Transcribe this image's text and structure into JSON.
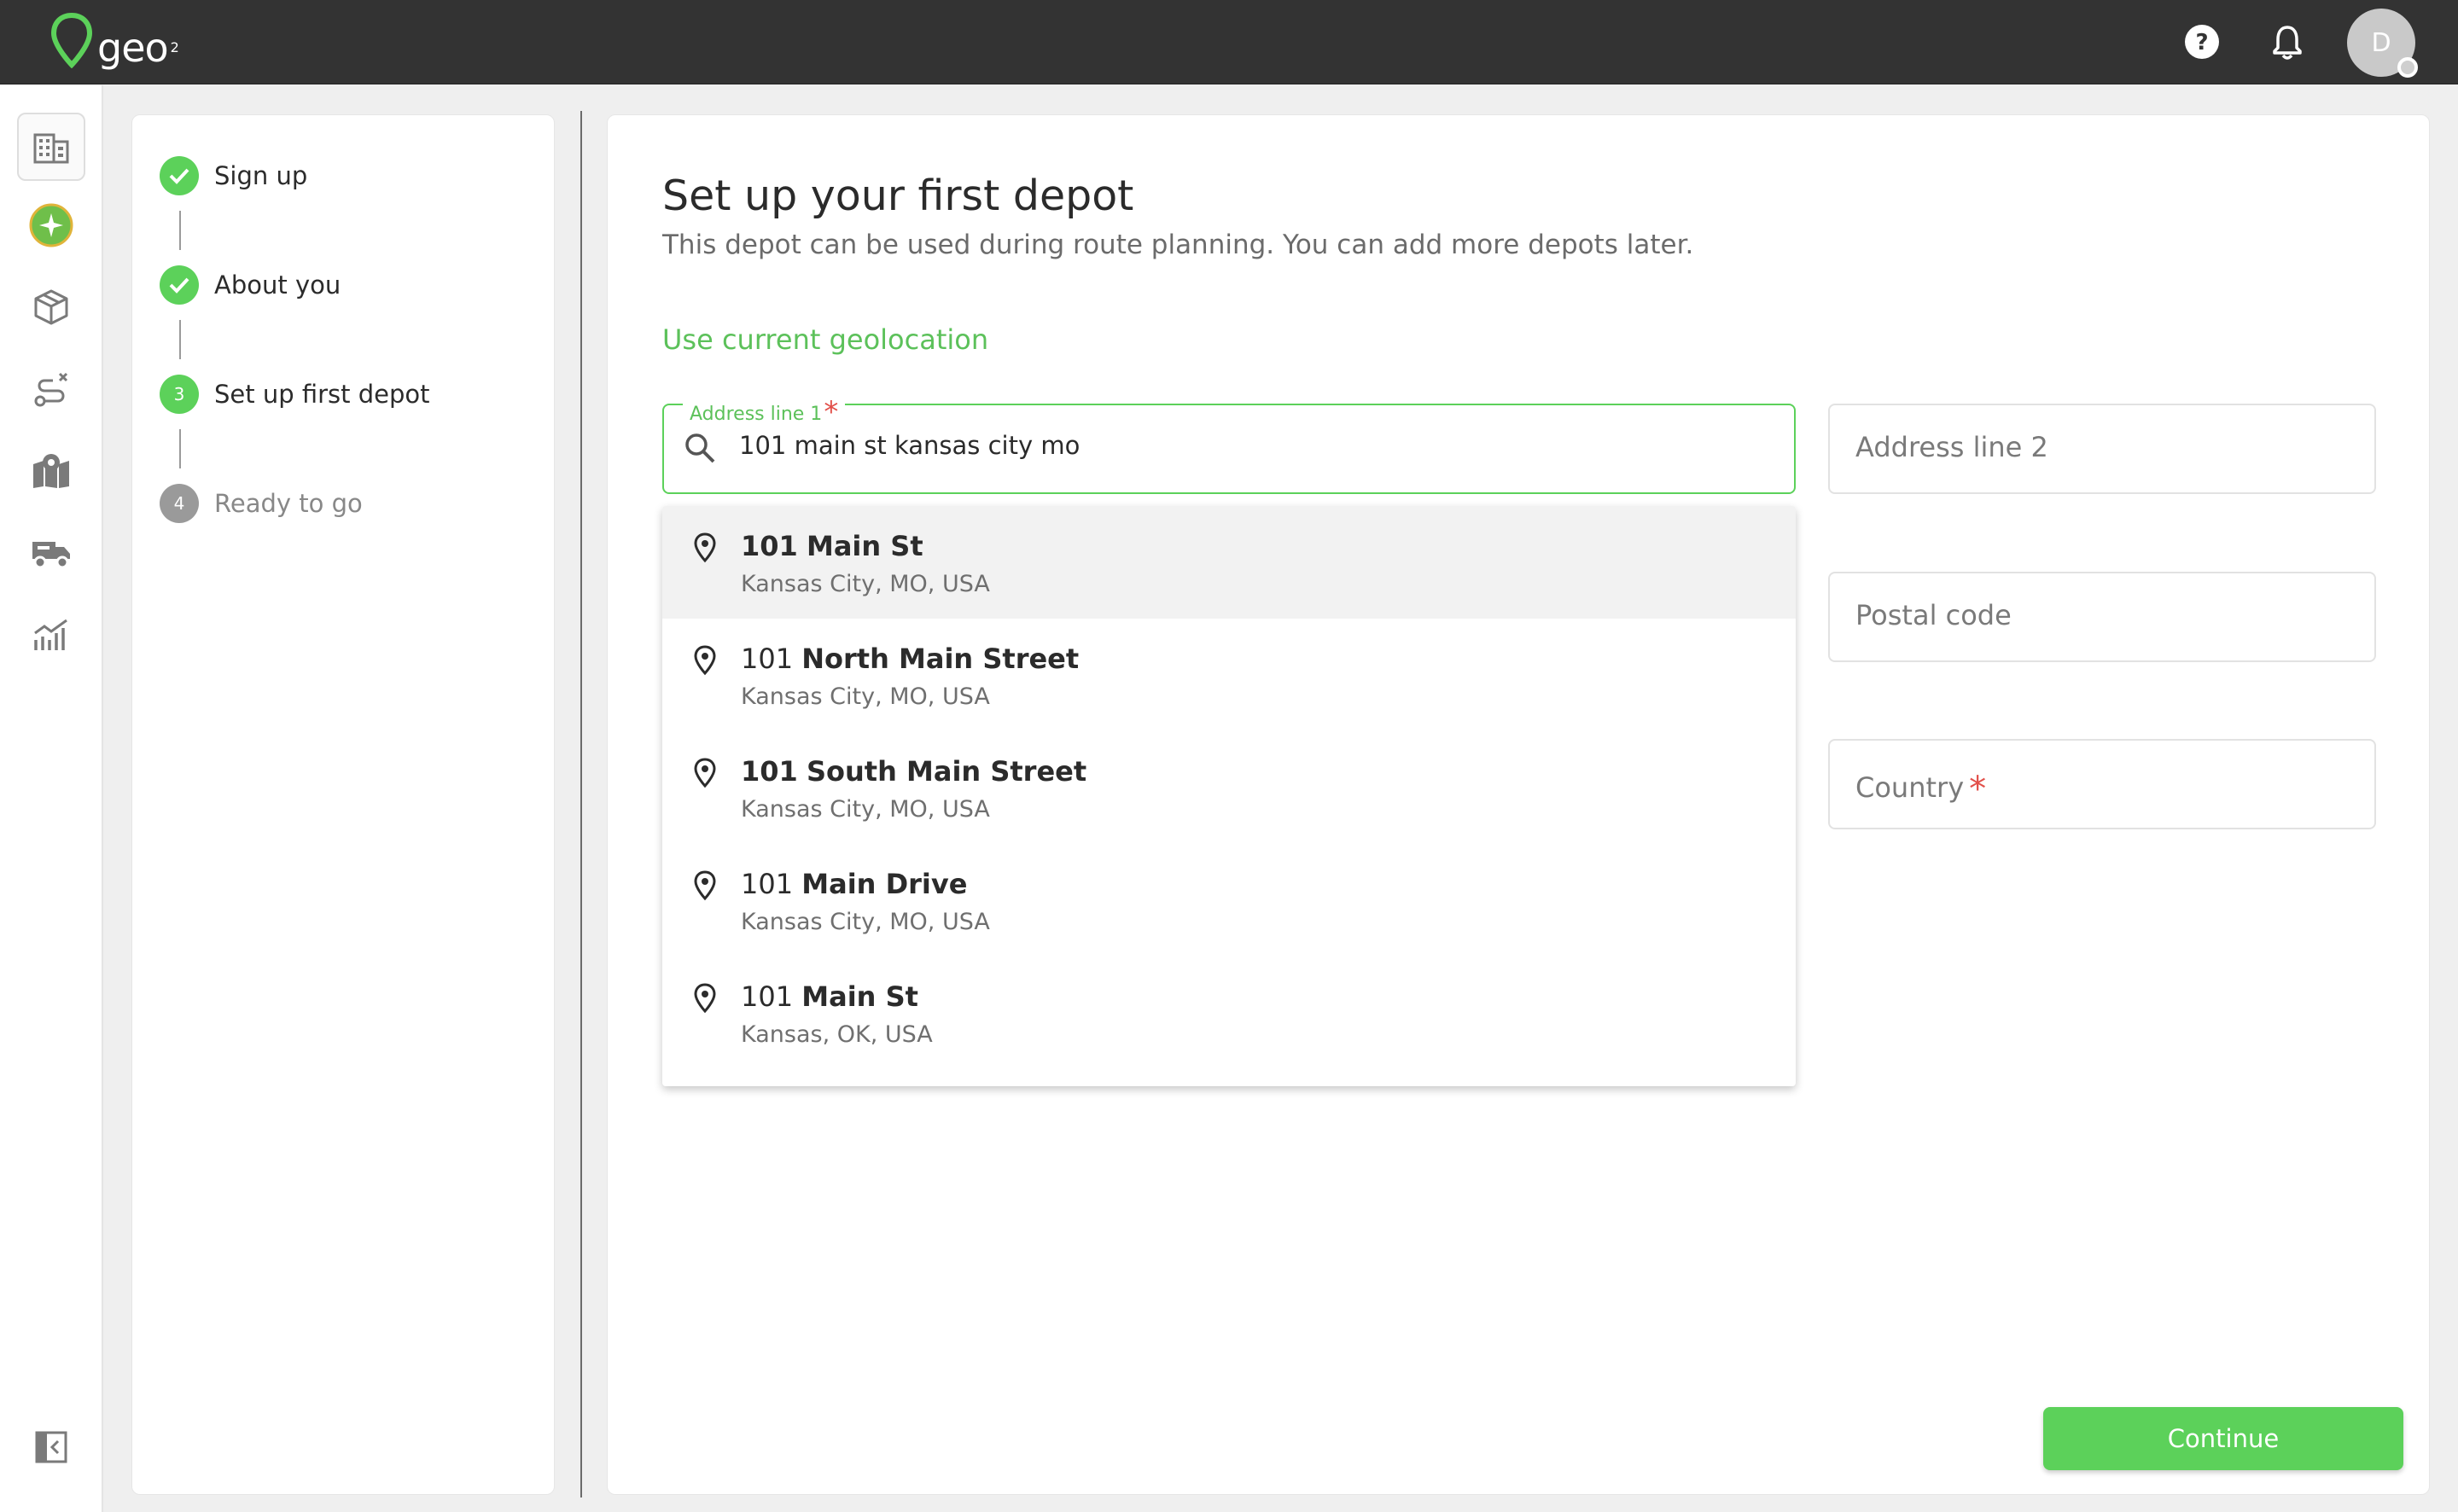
{
  "app": {
    "logo_text": "geo",
    "logo_sub": "2",
    "avatar_initial": "D",
    "brand_color": "#5cd15a"
  },
  "topbar": {
    "icons": [
      "help-icon",
      "bell-icon"
    ]
  },
  "rail": {
    "items": [
      "building-icon",
      "planet-icon",
      "package-icon",
      "route-icon",
      "map-icon",
      "truck-icon",
      "analytics-icon"
    ],
    "collapse_icon": "collapse-sidebar-icon"
  },
  "steps": [
    {
      "label": "Sign up",
      "status": "done",
      "number": "1"
    },
    {
      "label": "About you",
      "status": "done",
      "number": "2"
    },
    {
      "label": "Set up first depot",
      "status": "current",
      "number": "3"
    },
    {
      "label": "Ready to go",
      "status": "todo",
      "number": "4"
    }
  ],
  "main": {
    "title": "Set up your first depot",
    "subtitle": "This depot can be used during route planning. You can add more depots later.",
    "geolocation_link": "Use current geolocation",
    "address1": {
      "label": "Address line 1",
      "required_mark": "*",
      "value": "101 main st kansas city mo"
    },
    "address2": {
      "placeholder": "Address line 2"
    },
    "postal": {
      "placeholder": "Postal code"
    },
    "country": {
      "placeholder": "Country",
      "required_mark": "*"
    },
    "continue_label": "Continue"
  },
  "suggestions": [
    {
      "number": "101",
      "street": "Main St",
      "region": "Kansas City, MO, USA",
      "number_bold": true
    },
    {
      "number": "101",
      "street": "North Main Street",
      "region": "Kansas City, MO, USA",
      "number_bold": false
    },
    {
      "number": "101",
      "street": "South Main Street",
      "region": "Kansas City, MO, USA",
      "number_bold": true
    },
    {
      "number": "101",
      "street": "Main Drive",
      "region": "Kansas City, MO, USA",
      "number_bold": false
    },
    {
      "number": "101",
      "street": "Main St",
      "region": "Kansas, OK, USA",
      "number_bold": false
    }
  ]
}
